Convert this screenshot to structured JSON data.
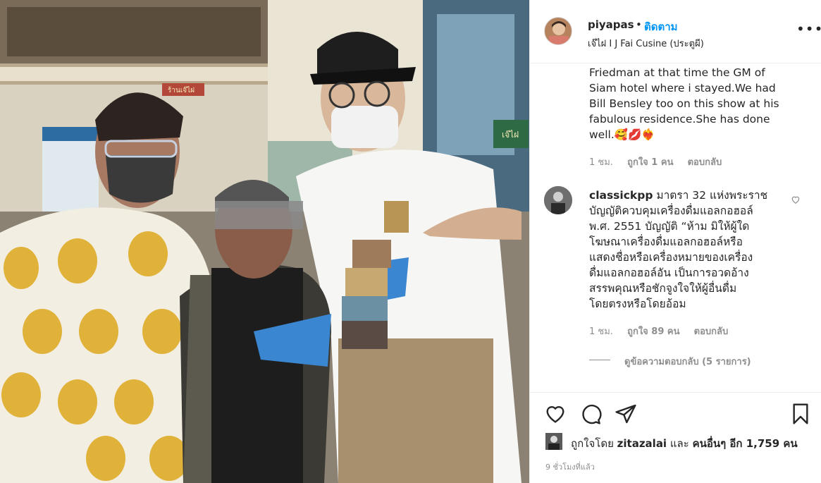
{
  "post": {
    "username": "piyapas",
    "dot": "•",
    "follow_label": "ติดตาม",
    "location": "เจ๊ไฝ I J Fai Cusine (ประตูผี)",
    "more_icon": "more-horizontal-icon"
  },
  "comments": [
    {
      "text_lines": [
        "Friedman at that time the GM of",
        "Siam hotel where i stayed.We had",
        "Bill Bensley too on this show at his",
        "fabulous residence.She has done",
        "well.🥰💋❤️‍🔥"
      ],
      "time": "1 ชม.",
      "likes": "ถูกใจ 1 คน",
      "reply": "ตอบกลับ"
    },
    {
      "username": "classickpp",
      "text_lines": [
        "มาตรา 32 แห่งพระราช",
        "บัญญัติควบคุมเครื่องดื่มแอลกอฮอล์",
        "พ.ศ. 2551 บัญญัติ “ห้าม มิให้ผู้ใด",
        "โฆษณาเครื่องดื่มแอลกอฮอล์หรือ",
        "แสดงชื่อหรือเครื่องหมายของเครื่อง",
        "ดื่มแอลกอฮอล์อัน เป็นการอวดอ้าง",
        "สรรพคุณหรือชักจูงใจให้ผู้อื่นดื่ม",
        "โดยตรงหรือโดยอ้อม"
      ],
      "time": "1 ชม.",
      "likes": "ถูกใจ 89 คน",
      "reply": "ตอบกลับ",
      "view_replies": "ดูข้อความตอบกลับ (5 รายการ)"
    }
  ],
  "actions": {
    "like_icon": "heart-icon",
    "comment_icon": "comment-icon",
    "share_icon": "share-icon",
    "save_icon": "bookmark-icon"
  },
  "likes_summary": {
    "prefix": "ถูกใจโดย",
    "user": "zitazalai",
    "and": "และ",
    "others": "คนอื่นๆ อีก 1,759 คน"
  },
  "timestamp": "9 ชั่วโมงที่แล้ว",
  "photo_signs": {
    "shop_sign": "เจ๊ไฝ",
    "top_sign": "ร้านเจ๊ไฝ"
  }
}
